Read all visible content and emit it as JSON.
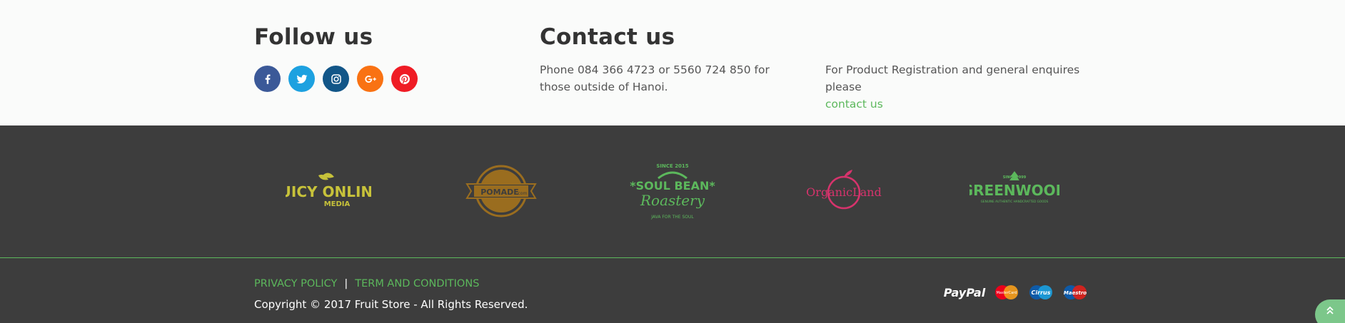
{
  "follow": {
    "title": "Follow us",
    "socials": [
      {
        "icon": "facebook-icon",
        "color": "#3b5998"
      },
      {
        "icon": "twitter-icon",
        "color": "#1da1e0"
      },
      {
        "icon": "instagram-icon",
        "color": "#125688"
      },
      {
        "icon": "google-plus-icon",
        "color": "#f97213"
      },
      {
        "icon": "pinterest-icon",
        "color": "#ef1c25"
      }
    ]
  },
  "contact": {
    "title": "Contact us",
    "phone_text": "Phone 084 366 4723 or 5560 724 850 for those outside of Hanoi.",
    "registration_text": "For Product Registration and general enquires please",
    "contact_link": "contact us"
  },
  "brands": [
    {
      "name": "juicy-online-media-logo",
      "line1": "JUICY ONLINE",
      "line2": "MEDIA",
      "color": "#c7c23a"
    },
    {
      "name": "pomade-logo",
      "line1": "POMADE",
      "line2": ".com",
      "color": "#9a6d1f"
    },
    {
      "name": "soul-bean-roastery-logo",
      "top": "SINCE 2015",
      "line1": "*SOUL BEAN*",
      "line2": "Roastery",
      "bottom": "JAVA FOR THE SOUL",
      "color": "#5cb85c"
    },
    {
      "name": "organic-land-logo",
      "line1": "OrganicLand",
      "color": "#d6336c"
    },
    {
      "name": "greenwood-logo",
      "top": "SINCE 1999",
      "line1": "GREENWOOD",
      "line2": "GENUINE AUTHENTIC HANDCRAFTED GOODS",
      "color": "#5cb85c"
    }
  ],
  "footer": {
    "privacy": "PRIVACY POLICY",
    "separator": "|",
    "terms": "TERM AND CONDITIONS",
    "copyright": "Copyright © 2017 Fruit Store - All Rights Reserved.",
    "payments": [
      "PayPal",
      "MasterCard",
      "Cirrus",
      "Maestro"
    ]
  },
  "colors": {
    "accent": "#5cb85c",
    "dark_bg": "#3d3d3d"
  }
}
